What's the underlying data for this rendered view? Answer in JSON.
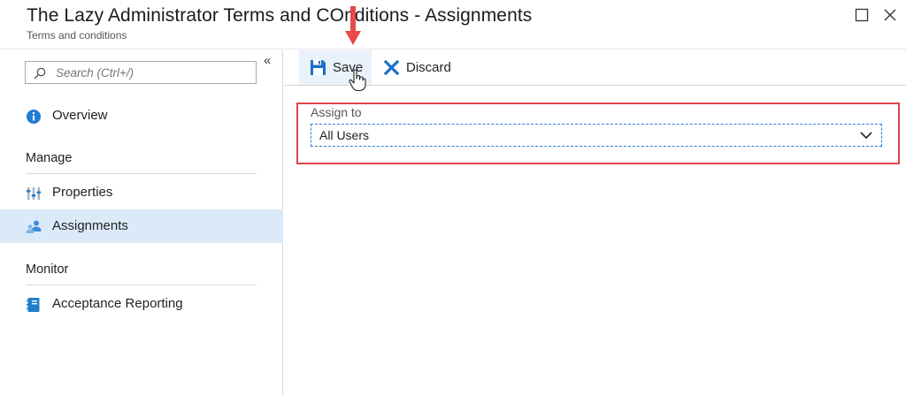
{
  "header": {
    "title": "The Lazy Administrator Terms and COnditions - Assignments",
    "subtitle": "Terms and conditions",
    "maximize_icon": "maximize-icon",
    "close_icon": "close-icon"
  },
  "sidebar": {
    "collapse_label": "«",
    "search": {
      "placeholder": "Search (Ctrl+/)",
      "value": ""
    },
    "overview": {
      "label": "Overview",
      "icon": "info-icon"
    },
    "manage": {
      "heading": "Manage",
      "items": [
        {
          "label": "Properties",
          "icon": "properties-icon"
        },
        {
          "label": "Assignments",
          "icon": "assignments-icon",
          "active": true
        }
      ]
    },
    "monitor": {
      "heading": "Monitor",
      "items": [
        {
          "label": "Acceptance Reporting",
          "icon": "notebook-icon"
        }
      ]
    }
  },
  "toolbar": {
    "save_label": "Save",
    "discard_label": "Discard"
  },
  "form": {
    "assign_to_label": "Assign to",
    "assign_to_value": "All Users"
  },
  "colors": {
    "accent": "#0078d4",
    "active_bg": "#dbeaf8",
    "annotation_red": "#e0474a"
  }
}
